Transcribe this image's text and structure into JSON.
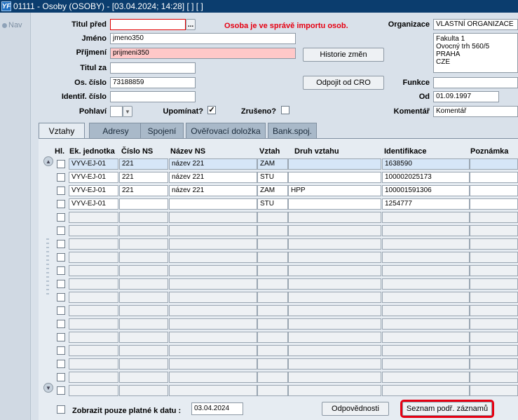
{
  "window": {
    "title": "01111 - Osoby (OSOBY) - [03.04.2024; 14:28] [ ] [ ]",
    "icon_text": "YF"
  },
  "nav": {
    "label": "Nav"
  },
  "form": {
    "titul_pred_label": "Titul před",
    "titul_pred_value": "",
    "jmeno_label": "Jméno",
    "jmeno_value": "jmeno350",
    "prijmeni_label": "Příjmení",
    "prijmeni_value": "prijmeni350",
    "titul_za_label": "Titul za",
    "titul_za_value": "",
    "os_cislo_label": "Os. číslo",
    "os_cislo_value": "73188859",
    "identif_label": "Identif. číslo",
    "identif_value": "",
    "pohlavi_label": "Pohlaví",
    "pohlavi_value": "",
    "upominat_label": "Upomínat?",
    "zruseno_label": "Zrušeno?",
    "import_warning": "Osoba je ve správě importu osob.",
    "historie_button": "Historie změn",
    "odpojit_button": "Odpojit od CRO",
    "organizace_label": "Organizace",
    "organizace_value": "VLASTNÍ ORGANIZACE",
    "address_lines": [
      "Fakulta 1",
      "Ovocný trh 560/5",
      "PRAHA",
      "CZE"
    ],
    "funkce_label": "Funkce",
    "funkce_value": "",
    "od_label": "Od",
    "od_value": "01.09.1997",
    "komentar_label": "Komentář",
    "komentar_value": "Komentář",
    "lookup_button": "..."
  },
  "tabs": [
    "Vztahy",
    "Adresy",
    "Spojení",
    "Ověřovací doložka",
    "Bank.spoj."
  ],
  "table": {
    "headers": [
      "Hl.",
      "Ek. jednotka",
      "Číslo NS",
      "Název NS",
      "Vztah",
      "Druh vztahu",
      "Identifikace",
      "Poznámka"
    ],
    "rows": [
      [
        "VYV-EJ-01",
        "221",
        "název 221",
        "ZAM",
        "",
        "1638590",
        ""
      ],
      [
        "VYV-EJ-01",
        "221",
        "název 221",
        "STU",
        "",
        "100002025173",
        ""
      ],
      [
        "VYV-EJ-01",
        "221",
        "název 221",
        "ZAM",
        "HPP",
        "100001591306",
        ""
      ],
      [
        "VYV-EJ-01",
        "",
        "",
        "STU",
        "",
        "1254777",
        ""
      ]
    ]
  },
  "footer": {
    "zobrazit_label": "Zobrazit pouze platné k datu :",
    "date_value": "03.04.2024",
    "odpovednosti_button": "Odpovědnosti",
    "seznam_button": "Seznam podř. záznamů"
  }
}
